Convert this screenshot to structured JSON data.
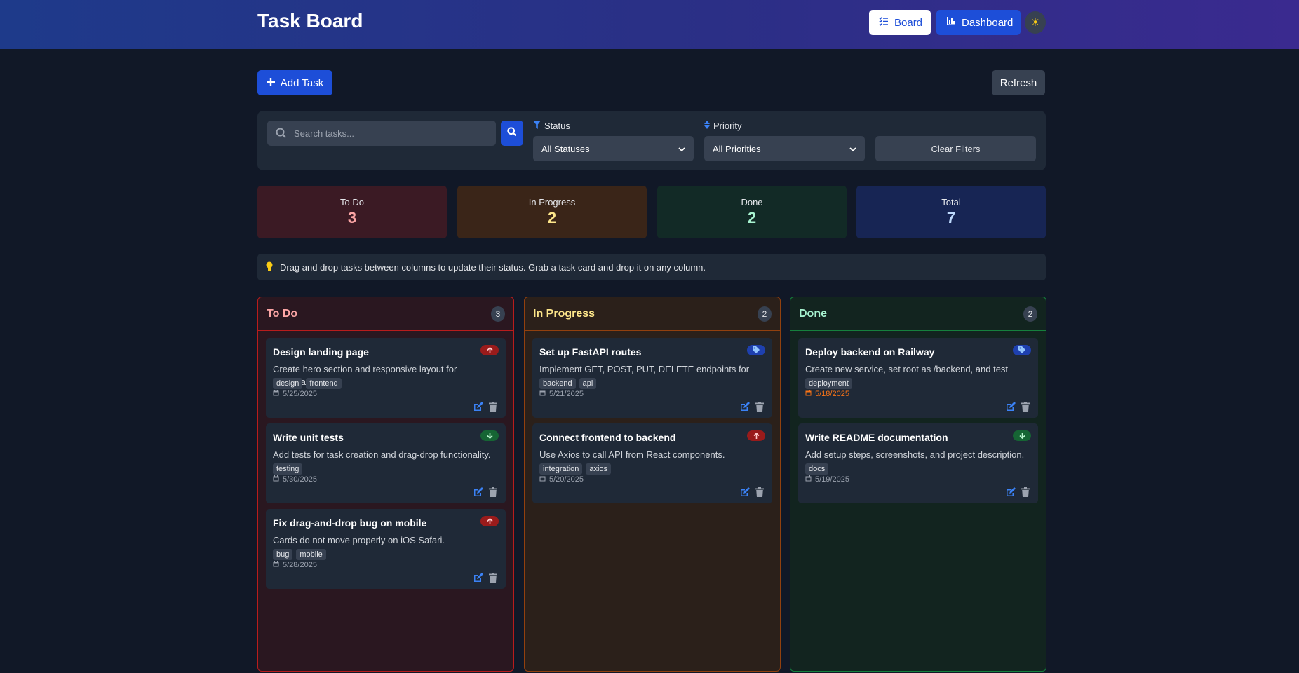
{
  "header": {
    "title": "Task Board",
    "nav": [
      {
        "label": "Board",
        "icon": "list-check-icon",
        "active": true
      },
      {
        "label": "Dashboard",
        "icon": "bar-chart-icon",
        "active": false
      }
    ],
    "theme_icon": "sun-icon"
  },
  "toolbar": {
    "add_label": "Add Task",
    "refresh_label": "Refresh"
  },
  "filters": {
    "search_placeholder": "Search tasks...",
    "status_label": "Status",
    "status_value": "All Statuses",
    "priority_label": "Priority",
    "priority_value": "All Priorities",
    "clear_label": "Clear Filters"
  },
  "stats": [
    {
      "label": "To Do",
      "value": "3",
      "bg": "#3b1a24",
      "color": "#fca5a5"
    },
    {
      "label": "In Progress",
      "value": "2",
      "bg": "#3a2518",
      "color": "#fde68a"
    },
    {
      "label": "Done",
      "value": "2",
      "bg": "#122a26",
      "color": "#a7f3d0"
    },
    {
      "label": "Total",
      "value": "7",
      "bg": "#172554",
      "color": "#bfdbfe"
    }
  ],
  "hint": "Drag and drop tasks between columns to update their status. Grab a task card and drop it on any column.",
  "columns": [
    {
      "title": "To Do",
      "count": "3",
      "title_color": "#fca5a5",
      "border": "#b91c1c",
      "bg": "#2a1720",
      "cards": [
        {
          "title": "Design landing page",
          "priority": "high",
          "desc": "Create hero section and responsive layout for homepage.",
          "tags": [
            "design",
            "frontend"
          ],
          "date": "5/25/2025"
        },
        {
          "title": "Write unit tests",
          "priority": "low",
          "desc": "Add tests for task creation and drag-drop functionality.",
          "tags": [
            "testing"
          ],
          "date": "5/30/2025"
        },
        {
          "title": "Fix drag-and-drop bug on mobile",
          "priority": "high",
          "desc": "Cards do not move properly on iOS Safari.",
          "tags": [
            "bug",
            "mobile"
          ],
          "date": "5/28/2025"
        }
      ]
    },
    {
      "title": "In Progress",
      "count": "2",
      "title_color": "#fde68a",
      "border": "#92400e",
      "bg": "#2b201a",
      "cards": [
        {
          "title": "Set up FastAPI routes",
          "priority": "medium",
          "desc": "Implement GET, POST, PUT, DELETE endpoints for tasks.",
          "tags": [
            "backend",
            "api"
          ],
          "date": "5/21/2025"
        },
        {
          "title": "Connect frontend to backend",
          "priority": "high",
          "desc": "Use Axios to call API from React components.",
          "tags": [
            "integration",
            "axios"
          ],
          "date": "5/20/2025"
        }
      ]
    },
    {
      "title": "Done",
      "count": "2",
      "title_color": "#a7f3d0",
      "border": "#15803d",
      "bg": "#12241f",
      "cards": [
        {
          "title": "Deploy backend on Railway",
          "priority": "medium",
          "desc": "Create new service, set root as /backend, and test endpoints.",
          "tags": [
            "deployment"
          ],
          "date": "5/18/2025",
          "overdue": true
        },
        {
          "title": "Write README documentation",
          "priority": "low",
          "desc": "Add setup steps, screenshots, and project description.",
          "tags": [
            "docs"
          ],
          "date": "5/19/2025"
        }
      ]
    }
  ]
}
